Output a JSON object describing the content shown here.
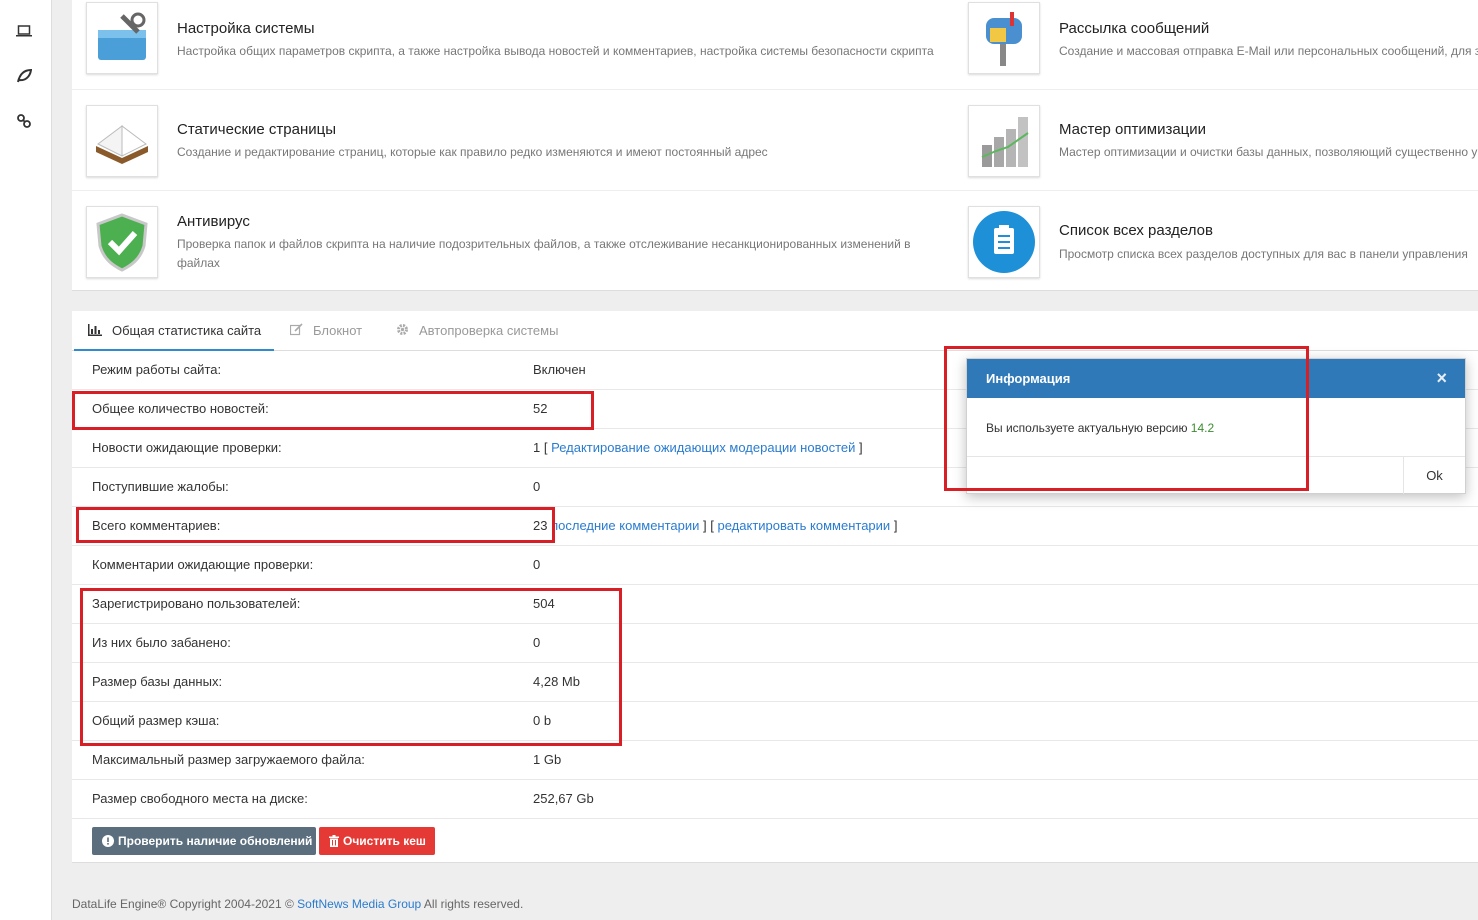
{
  "sidebar": {
    "icons": [
      "laptop-icon",
      "leaf-icon",
      "link-icon"
    ]
  },
  "modules": [
    {
      "title": "Настройка системы",
      "desc": "Настройка общих параметров скрипта, а также настройка вывода новостей и комментариев, настройка системы безопасности скрипта",
      "icon": "toolbox-icon"
    },
    {
      "title": "Рассылка сообщений",
      "desc": "Создание и массовая отправка E-Mail или персональных сообщений, для за",
      "icon": "mailbox-icon"
    },
    {
      "title": "Статические страницы",
      "desc": "Создание и редактирование страниц, которые как правило редко изменяются и имеют постоянный адрес",
      "icon": "book-icon"
    },
    {
      "title": "Мастер оптимизации",
      "desc": "Мастер оптимизации и очистки базы данных, позволяющий существенно у",
      "icon": "chart-blocks-icon"
    },
    {
      "title": "Антивирус",
      "desc": "Проверка папок и файлов скрипта на наличие подозрительных файлов, а также отслеживание несанкционированных изменений в файлах",
      "icon": "shield-check-icon"
    },
    {
      "title": "Список всех разделов",
      "desc": "Просмотр списка всех разделов доступных для вас в панели управления",
      "icon": "clipboard-list-icon"
    }
  ],
  "tabs": [
    {
      "label": "Общая статистика сайта",
      "icon": "bar-chart-icon",
      "active": true
    },
    {
      "label": "Блокнот",
      "icon": "edit-icon",
      "active": false
    },
    {
      "label": "Автопроверка системы",
      "icon": "gear-icon",
      "active": false
    }
  ],
  "stats": {
    "mode": {
      "label": "Режим работы сайта:",
      "value": "Включен"
    },
    "news_total": {
      "label": "Общее количество новостей:",
      "value": "52"
    },
    "news_pending": {
      "label": "Новости ожидающие проверки:",
      "value": "1",
      "bracket_open": "[",
      "link": "Редактирование ожидающих модерации новостей",
      "bracket_close": "]"
    },
    "complaints": {
      "label": "Поступившие жалобы:",
      "value": "0"
    },
    "comments_total": {
      "label": "Всего комментариев:",
      "value": "23",
      "link1": "последние комментарии",
      "sep": "] [",
      "link2": "редактировать комментарии",
      "bracket_close": "]"
    },
    "comments_pending": {
      "label": "Комментарии ожидающие проверки:",
      "value": "0"
    },
    "users": {
      "label": "Зарегистрировано пользователей:",
      "value": "504"
    },
    "banned": {
      "label": "Из них было забанено:",
      "value": "0"
    },
    "db_size": {
      "label": "Размер базы данных:",
      "value": "4,28 Mb"
    },
    "cache_size": {
      "label": "Общий размер кэша:",
      "value": "0 b"
    },
    "max_upload": {
      "label": "Максимальный размер загружаемого файла:",
      "value": "1 Gb"
    },
    "free_disk": {
      "label": "Размер свободного места на диске:",
      "value": "252,67 Gb"
    }
  },
  "buttons": {
    "check_updates": "Проверить наличие обновлений",
    "clear_cache": "Очистить кеш"
  },
  "footer": {
    "text_before": "DataLife Engine® Copyright 2004-2021 ©",
    "link": "SoftNews Media Group",
    "text_after": "All rights reserved."
  },
  "modal": {
    "title": "Информация",
    "close": "×",
    "message": "Вы используете актуальную версию",
    "version": "14.2",
    "ok": "Ok"
  },
  "colors": {
    "accent_blue": "#2f79b9",
    "link": "#2a7ccf",
    "highlight_red": "#d81f26",
    "danger": "#e53935",
    "dark_button": "#5a6e7d"
  }
}
